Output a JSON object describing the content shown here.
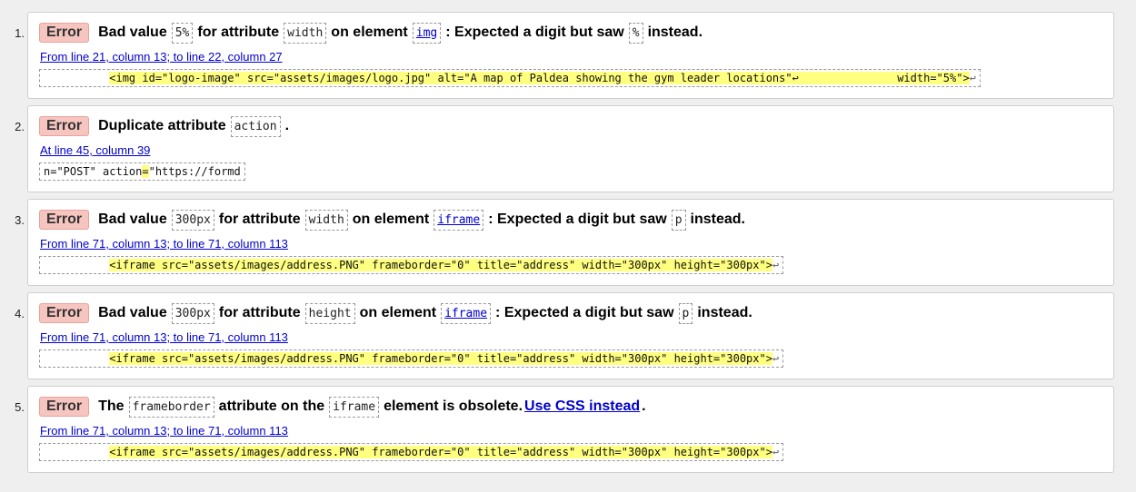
{
  "errors": [
    {
      "number": "1.",
      "badge": "Error",
      "parts": [
        {
          "type": "text",
          "value": "Bad value"
        },
        {
          "type": "code",
          "value": "5%"
        },
        {
          "type": "text",
          "value": "for attribute"
        },
        {
          "type": "code",
          "value": "width"
        },
        {
          "type": "text",
          "value": "on element"
        },
        {
          "type": "codelink",
          "value": "img"
        },
        {
          "type": "text",
          "value": ": Expected a digit but saw"
        },
        {
          "type": "code",
          "value": "%"
        },
        {
          "type": "text",
          "value": "instead."
        }
      ],
      "location": "From line 21, column 13; to line 22, column 27",
      "extract_pre": "          ",
      "extract_hl": "<img id=\"logo-image\" src=\"assets/images/logo.jpg\" alt=\"A map of Paldea showing the gym leader locations\"↩               width=\"5%\">",
      "extract_post": "↩"
    },
    {
      "number": "2.",
      "badge": "Error",
      "parts": [
        {
          "type": "text",
          "value": "Duplicate attribute"
        },
        {
          "type": "code",
          "value": "action"
        },
        {
          "type": "text",
          "value": "."
        }
      ],
      "location": "At line 45, column 39",
      "extract_pre": "n=\"POST\" action",
      "extract_hl": "=",
      "extract_post": "\"https://formd"
    },
    {
      "number": "3.",
      "badge": "Error",
      "parts": [
        {
          "type": "text",
          "value": "Bad value"
        },
        {
          "type": "code",
          "value": "300px"
        },
        {
          "type": "text",
          "value": "for attribute"
        },
        {
          "type": "code",
          "value": "width"
        },
        {
          "type": "text",
          "value": "on element"
        },
        {
          "type": "codelink",
          "value": "iframe"
        },
        {
          "type": "text",
          "value": ": Expected a digit but saw"
        },
        {
          "type": "code",
          "value": "p"
        },
        {
          "type": "text",
          "value": "instead."
        }
      ],
      "location": "From line 71, column 13; to line 71, column 113",
      "extract_pre": "          ",
      "extract_hl": "<iframe src=\"assets/images/address.PNG\" frameborder=\"0\" title=\"address\" width=\"300px\" height=\"300px\">",
      "extract_post": "↩"
    },
    {
      "number": "4.",
      "badge": "Error",
      "parts": [
        {
          "type": "text",
          "value": "Bad value"
        },
        {
          "type": "code",
          "value": "300px"
        },
        {
          "type": "text",
          "value": "for attribute"
        },
        {
          "type": "code",
          "value": "height"
        },
        {
          "type": "text",
          "value": "on element"
        },
        {
          "type": "codelink",
          "value": "iframe"
        },
        {
          "type": "text",
          "value": ": Expected a digit but saw"
        },
        {
          "type": "code",
          "value": "p"
        },
        {
          "type": "text",
          "value": "instead."
        }
      ],
      "location": "From line 71, column 13; to line 71, column 113",
      "extract_pre": "          ",
      "extract_hl": "<iframe src=\"assets/images/address.PNG\" frameborder=\"0\" title=\"address\" width=\"300px\" height=\"300px\">",
      "extract_post": "↩"
    },
    {
      "number": "5.",
      "badge": "Error",
      "parts": [
        {
          "type": "text",
          "value": "The"
        },
        {
          "type": "code",
          "value": "frameborder"
        },
        {
          "type": "text",
          "value": "attribute on the"
        },
        {
          "type": "code",
          "value": "iframe"
        },
        {
          "type": "text",
          "value": "element is obsolete."
        },
        {
          "type": "link",
          "value": "Use CSS instead"
        },
        {
          "type": "text",
          "value": "."
        }
      ],
      "location": "From line 71, column 13; to line 71, column 113",
      "extract_pre": "          ",
      "extract_hl": "<iframe src=\"assets/images/address.PNG\" frameborder=\"0\" title=\"address\" width=\"300px\" height=\"300px\">",
      "extract_post": "↩"
    }
  ]
}
